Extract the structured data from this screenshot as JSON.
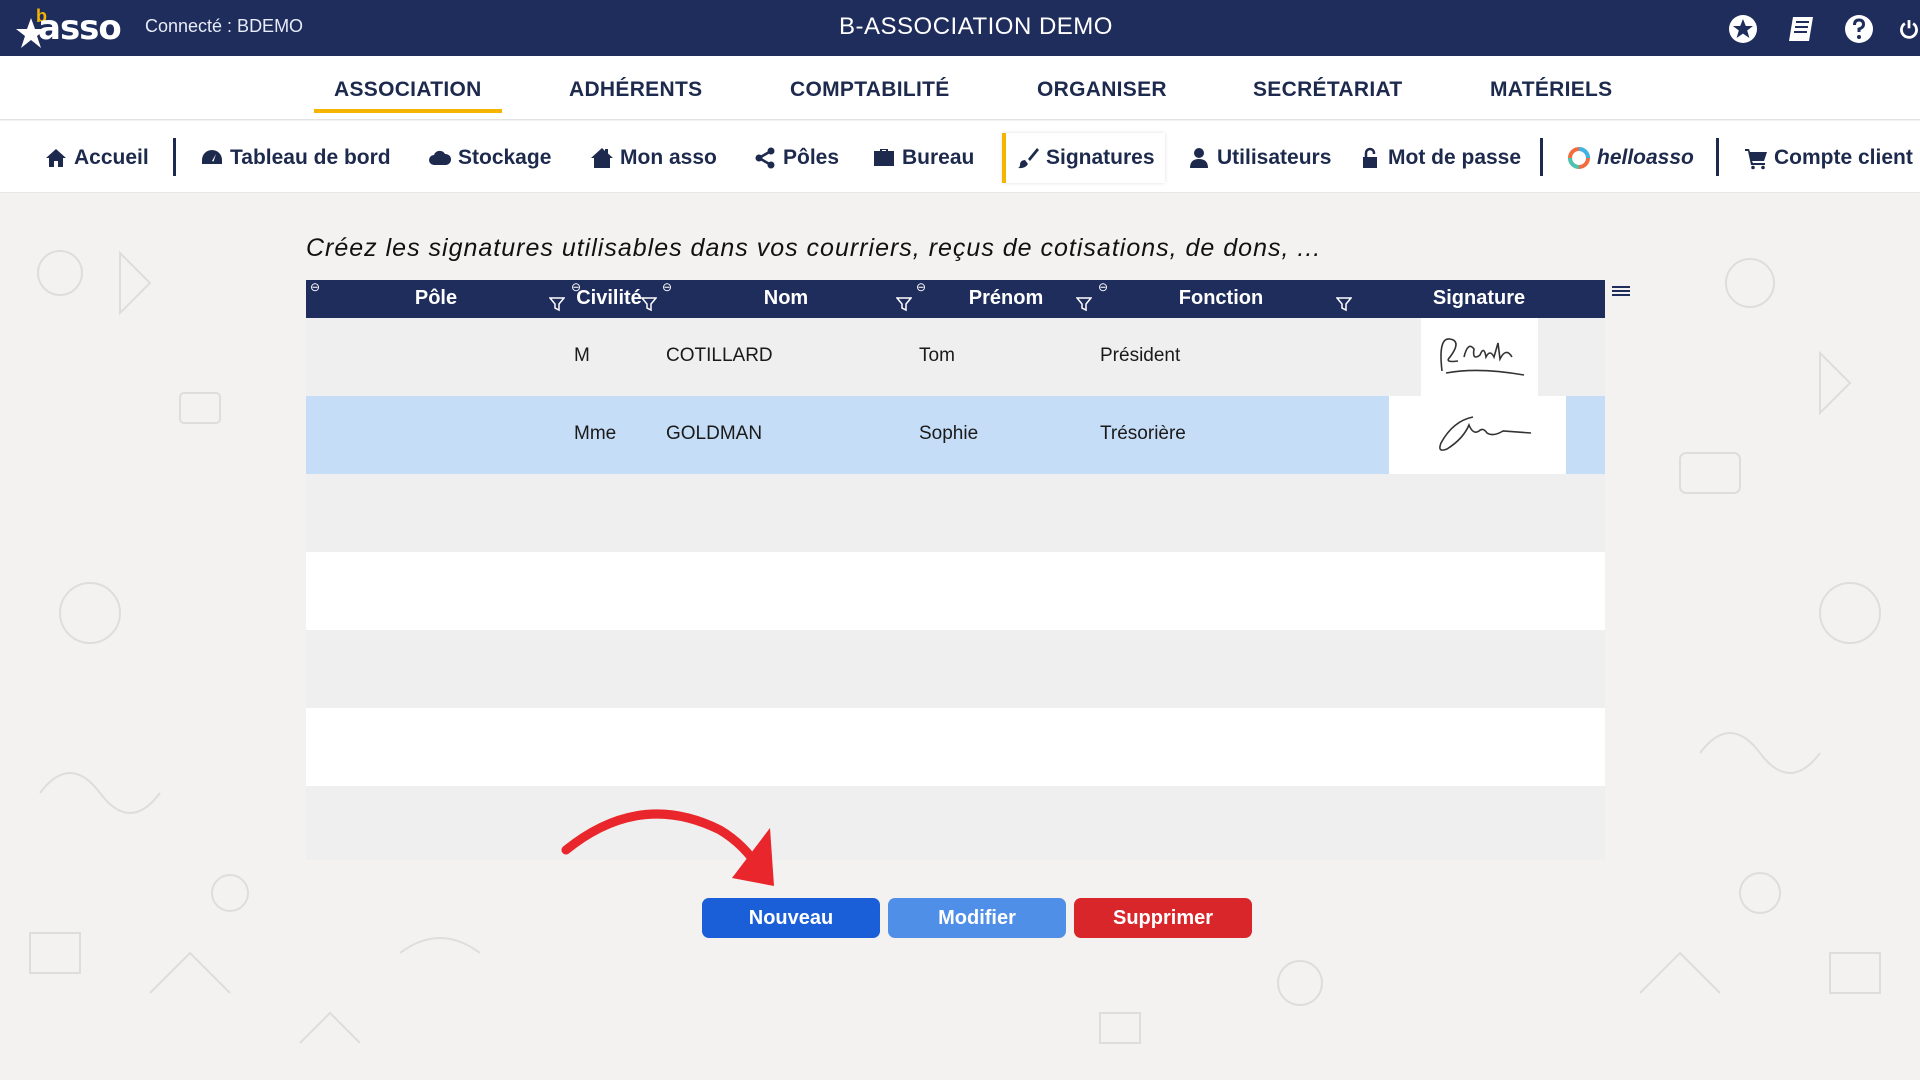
{
  "header": {
    "logo_text": "asso",
    "logo_letter": "b",
    "connected_label": "Connecté : BDEMO",
    "app_title": "B-ASSOCIATION DEMO",
    "icons": [
      "star-icon",
      "book-icon",
      "help-icon",
      "power-icon"
    ]
  },
  "main_nav": {
    "items": [
      {
        "label": "ASSOCIATION",
        "active": true
      },
      {
        "label": "ADHÉRENTS"
      },
      {
        "label": "COMPTABILITÉ"
      },
      {
        "label": "ORGANISER"
      },
      {
        "label": "SECRÉTARIAT"
      },
      {
        "label": "MATÉRIELS"
      }
    ]
  },
  "sub_nav": {
    "items": [
      {
        "label": "Accueil",
        "icon": "home-icon"
      },
      {
        "label": "Tableau de bord",
        "icon": "dashboard-icon"
      },
      {
        "label": "Stockage",
        "icon": "cloud-icon"
      },
      {
        "label": "Mon asso",
        "icon": "house-icon"
      },
      {
        "label": "Pôles",
        "icon": "share-icon"
      },
      {
        "label": "Bureau",
        "icon": "briefcase-icon"
      },
      {
        "label": "Signatures",
        "icon": "brush-icon",
        "active": true
      },
      {
        "label": "Utilisateurs",
        "icon": "user-icon"
      },
      {
        "label": "Mot de passe",
        "icon": "lock-icon"
      },
      {
        "label": "helloasso",
        "icon": "helloasso-icon"
      },
      {
        "label": "Compte client",
        "icon": "cart-icon"
      }
    ]
  },
  "intro_text": "Créez les signatures utilisables dans vos courriers, reçus de cotisations, de dons, ...",
  "grid": {
    "columns": [
      "Pôle",
      "Civilité",
      "Nom",
      "Prénom",
      "Fonction",
      "Signature"
    ],
    "rows": [
      {
        "pole": "",
        "civilite": "M",
        "nom": "COTILLARD",
        "prenom": "Tom",
        "fonction": "Président",
        "signature": "signature-image"
      },
      {
        "pole": "",
        "civilite": "Mme",
        "nom": "GOLDMAN",
        "prenom": "Sophie",
        "fonction": "Trésorière",
        "signature": "signature-image",
        "selected": true
      }
    ]
  },
  "buttons": {
    "new_label": "Nouveau",
    "edit_label": "Modifier",
    "delete_label": "Supprimer"
  },
  "colors": {
    "navy": "#1f2d5c",
    "accent": "#f5b400",
    "selected_row": "#c6ddf7",
    "btn_new": "#1a5fd8",
    "btn_edit": "#4f8fe8",
    "btn_delete": "#d9262a",
    "arrow": "#e8262b"
  }
}
